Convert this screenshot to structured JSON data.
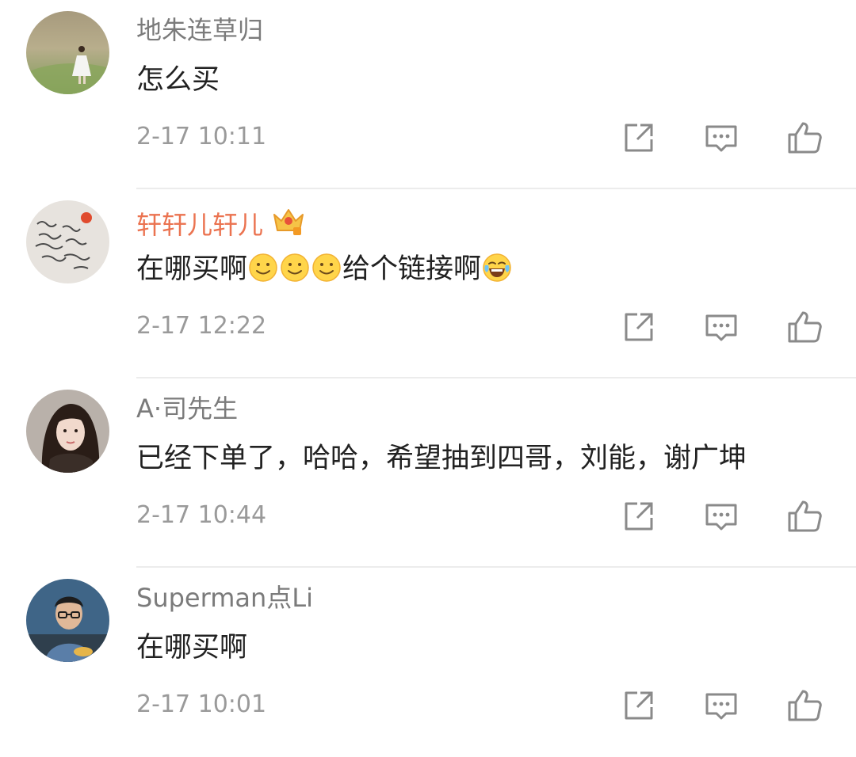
{
  "comments": [
    {
      "username": "地朱连草归",
      "vip": false,
      "text_parts": [
        "怎么买"
      ],
      "time": "2-17 10:11",
      "avatar": "girl-walking-on-grass-avatar"
    },
    {
      "username": "轩轩儿轩儿",
      "vip": true,
      "badge": "crown-badge-icon",
      "text_parts": [
        "在哪买啊",
        "给个链接啊"
      ],
      "emojis": [
        "smile-emoji",
        "smile-emoji",
        "smile-emoji",
        "laugh-cry-emoji"
      ],
      "time": "2-17 12:22",
      "avatar": "handwriting-avatar"
    },
    {
      "username": "A·司先生",
      "vip": false,
      "text_parts": [
        "已经下单了，哈哈，希望抽到四哥，刘能，谢广坤"
      ],
      "time": "2-17 10:44",
      "avatar": "woman-portrait-avatar"
    },
    {
      "username": "Superman点Li",
      "vip": false,
      "text_parts": [
        "在哪买啊"
      ],
      "time": "2-17 10:01",
      "avatar": "man-with-glasses-avatar"
    }
  ],
  "actions": {
    "share": "share-icon",
    "reply": "comment-icon",
    "like": "like-icon"
  },
  "colors": {
    "username": "#7b7b7b",
    "vip_username": "#eb7350",
    "text": "#222222",
    "time": "#9a9a9a",
    "icon": "#8a8a8a",
    "divider": "#ececec"
  }
}
